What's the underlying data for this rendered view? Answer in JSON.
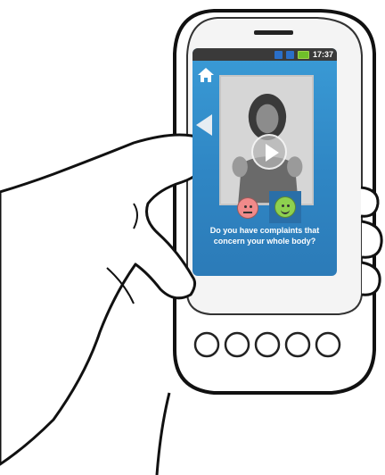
{
  "status_bar": {
    "time": "17:37"
  },
  "question": {
    "line1": "Do you have complaints that",
    "line2": "concern your whole body?"
  },
  "icons": {
    "home": "home-icon",
    "back": "back-arrow-icon",
    "play": "play-icon",
    "sad": "sad-face-icon",
    "happy": "happy-face-icon"
  },
  "colors": {
    "screen_blue": "#3a9bd6",
    "sad_face": "#f08a8a",
    "happy_face": "#8ed14f",
    "happy_highlight": "#2a6fa8"
  }
}
